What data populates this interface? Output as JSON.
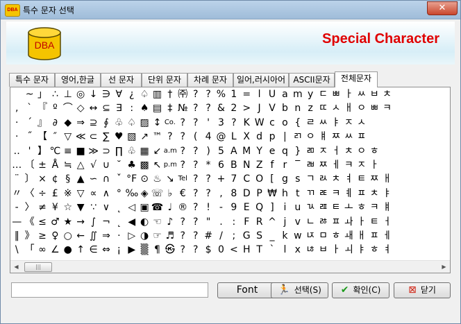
{
  "window": {
    "title": "특수 문자 선택",
    "app_icon_text": "DBA",
    "close_glyph": "✕"
  },
  "header": {
    "logo_text": "DBA",
    "title": "Special Character"
  },
  "tabs": [
    "특수 문자",
    "영어,한글",
    "선 문자",
    "단위 문자",
    "차례 문자",
    "일어,러시아어",
    "ASCII문자",
    "전체문자"
  ],
  "active_tab": "전체문자",
  "grid_rows": [
    [
      "",
      "~",
      "」",
      "∴",
      "⊥",
      "◎",
      "↓",
      "∋",
      "∀",
      "¿",
      "♤",
      "▥",
      "†",
      "㈜",
      "?",
      "?",
      "%",
      "1",
      "=",
      "l",
      "U",
      "a",
      "m",
      "y",
      "ㄷ",
      "ㅃ",
      "ㅏ",
      "ㅆ",
      "ㅂ",
      "ㅊ"
    ],
    [
      ",",
      "`",
      "『",
      "º",
      "⌒",
      "◇",
      "↔",
      "⊆",
      "∃",
      ":",
      "♠",
      "▤",
      "‡",
      "№",
      "?",
      "?",
      "&",
      "2",
      ">",
      "J",
      "V",
      "b",
      "n",
      "z",
      "ㄸ",
      "ㅅ",
      "ㅐ",
      "ㅇ",
      "ㅃ",
      "ㅋ"
    ],
    [
      "·",
      "´",
      "』",
      "∂",
      "◆",
      "⇒",
      "⊇",
      "∮",
      "♧",
      "♤",
      "▨",
      "↕",
      "Co.",
      "?",
      "?",
      "'",
      "3",
      "?",
      "K",
      "W",
      "c",
      "o",
      "{",
      "ㄹ",
      "ㅆ",
      "ㅑ",
      "ㅈ",
      "ㅅ"
    ],
    [
      "·",
      "˝",
      "【",
      "″",
      "▽",
      "≪",
      "⊂",
      "∑",
      "♥",
      "▧",
      "↗",
      "™",
      "?",
      "?",
      "(",
      "4",
      "@",
      "L",
      "X",
      "d",
      "p",
      "|",
      "ㄺ",
      "ㅇ",
      "ㅒ",
      "ㅉ",
      "ㅆ",
      "ㅍ"
    ],
    [
      "‥",
      "'",
      "】",
      "℃",
      "≡",
      "■",
      "≫",
      "⊃",
      "∏",
      "♧",
      "▦",
      "↙",
      "a.m.",
      "?",
      "?",
      ")",
      "5",
      "A",
      "M",
      "Y",
      "e",
      "q",
      "}",
      "ㄻ",
      "ㅈ",
      "ㅓ",
      "ㅊ",
      "ㅇ",
      "ㅎ"
    ],
    [
      "…",
      "〔",
      "±",
      "Å",
      "≒",
      "△",
      "√",
      "∪",
      "˘",
      "♣",
      "▩",
      "↖",
      "p.m.",
      "?",
      "?",
      "*",
      "6",
      "B",
      "N",
      "Z",
      "f",
      "r",
      "‾",
      "ㄼ",
      "ㅉ",
      "ㅔ",
      "ㅋ",
      "ㅈ",
      "ㅏ"
    ],
    [
      "¨",
      "〕",
      "×",
      "¢",
      "§",
      "▲",
      "∽",
      "∩",
      "ˇ",
      "°F",
      "⊙",
      "♨",
      "↘",
      "Tel",
      "?",
      "?",
      "+",
      "7",
      "C",
      "O",
      "[",
      "g",
      "s",
      "ㄱ",
      "ㄽ",
      "ㅊ",
      "ㅕ",
      "ㅌ",
      "ㅉ",
      "ㅐ"
    ],
    [
      "〃",
      "〈",
      "÷",
      "£",
      "※",
      "▽",
      "∝",
      "∧",
      "°",
      "‰",
      "◈",
      "☏",
      "♭",
      "€",
      "?",
      "?",
      ",",
      "8",
      "D",
      "P",
      "₩",
      "h",
      "t",
      "ㄲ",
      "ㄾ",
      "ㅋ",
      "ㅖ",
      "ㅍ",
      "ㅊ",
      "ㅑ"
    ],
    [
      "-",
      "〉",
      "≠",
      "¥",
      "☆",
      "▼",
      "∵",
      "∨",
      "˛",
      "◁",
      "▣",
      "☎",
      "♩",
      "®",
      "?",
      "!",
      "-",
      "9",
      "E",
      "Q",
      "]",
      "i",
      "u",
      "ㄳ",
      "ㄿ",
      "ㅌ",
      "ㅗ",
      "ㅎ",
      "ㅋ",
      "ㅒ"
    ],
    [
      "—",
      "《",
      "≤",
      "♂",
      "★",
      "→",
      "∫",
      "¬",
      "˛",
      "◀",
      "◐",
      "☜",
      "♪",
      "?",
      "?",
      "\"",
      ".",
      ":",
      "F",
      "R",
      "^",
      "j",
      "v",
      "ㄴ",
      "ㅀ",
      "ㅍ",
      "ㅘ",
      "ㅏ",
      "ㅌ",
      "ㅓ"
    ],
    [
      "‖",
      "》",
      "≥",
      "♀",
      "○",
      "←",
      "∬",
      "⇒",
      "·",
      "▷",
      "◑",
      "☞",
      "♬",
      "?",
      "?",
      "#",
      "/",
      ";",
      "G",
      "S",
      "_",
      "k",
      "w",
      "ㄵ",
      "ㅁ",
      "ㅎ",
      "ㅙ",
      "ㅐ",
      "ㅍ",
      "ㅔ"
    ],
    [
      "\\",
      "「",
      "∞",
      "∠",
      "●",
      "↑",
      "∈",
      "⇔",
      "¡",
      "▶",
      "▒",
      "¶",
      "㉿",
      "?",
      "?",
      "$",
      "0",
      "<",
      "H",
      "T",
      "`",
      "l",
      "x",
      "ㄶ",
      "ㅂ",
      "ㅏ",
      "ㅚ",
      "ㅑ",
      "ㅎ",
      "ㅕ"
    ]
  ],
  "scrollbar": {
    "left_arrow": "◀",
    "right_arrow": "▶",
    "thumb_glyph": "|||"
  },
  "bottom": {
    "input_value": "",
    "font_button": "Font",
    "select_button": "선택(S)",
    "ok_button": "확인(C)",
    "close_button": "닫기",
    "select_icon": "🏃",
    "ok_icon": "✔",
    "close_icon": "⊠"
  },
  "colors": {
    "header_title": "#e00000",
    "logo_fill": "#f5c400",
    "ok_check": "#1a9a1a",
    "select_icon": "#1a9a1a",
    "close_icon": "#d02010"
  }
}
